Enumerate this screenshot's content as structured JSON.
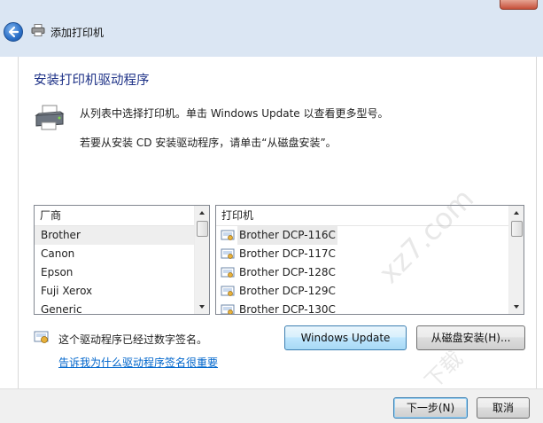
{
  "window": {
    "title": "添加打印机",
    "close_label": ""
  },
  "page": {
    "heading": "安装打印机驱动程序",
    "desc1": "从列表中选择打印机。单击 Windows Update 以查看更多型号。",
    "desc2": "若要从安装 CD 安装驱动程序，请单击“从磁盘安装”。"
  },
  "manufacturers": {
    "header": "厂商",
    "items": [
      "Brother",
      "Canon",
      "Epson",
      "Fuji Xerox",
      "Generic"
    ],
    "selected": "Brother"
  },
  "printers": {
    "header": "打印机",
    "items": [
      "Brother DCP-116C",
      "Brother DCP-117C",
      "Brother DCP-128C",
      "Brother DCP-129C",
      "Brother DCP-130C"
    ],
    "selected": "Brother DCP-116C"
  },
  "signature": {
    "text": "这个驱动程序已经过数字签名。",
    "link": "告诉我为什么驱动程序签名很重要"
  },
  "buttons": {
    "windows_update": "Windows Update",
    "have_disk": "从磁盘安装(H)...",
    "next": "下一步(N)",
    "cancel": "取消"
  },
  "watermark": {
    "line1": "xz7.com",
    "line2": "下载"
  },
  "colors": {
    "heading": "#1e3287",
    "link": "#0066cc",
    "titlebar": "#dbe6f3",
    "footer": "#f0f0f0"
  },
  "icons": [
    "back-arrow-icon",
    "printer-icon",
    "shield-certificate-icon",
    "printer-driver-icon",
    "close-icon"
  ]
}
